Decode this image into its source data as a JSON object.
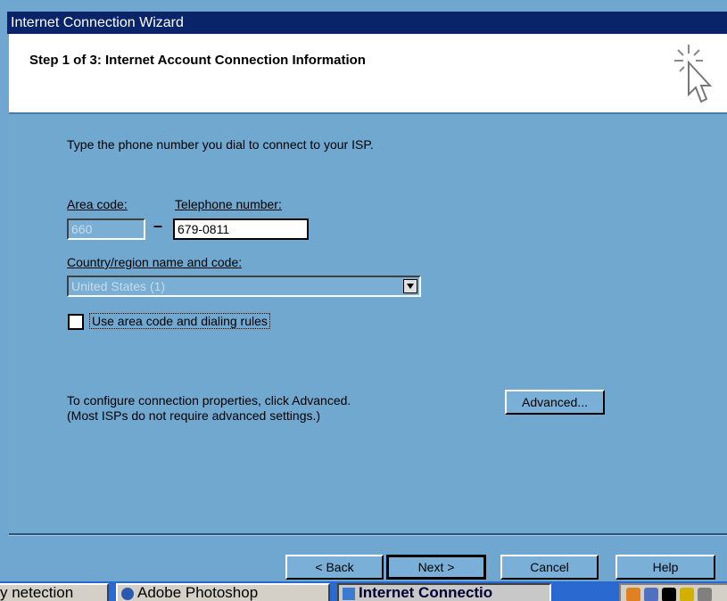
{
  "window": {
    "title": "Internet Connection Wizard"
  },
  "header": {
    "title": "Step 1 of 3: Internet Account Connection Information"
  },
  "instructions": "Type the phone number you dial to connect to your ISP.",
  "area_code": {
    "label": "Area code:",
    "value": "660"
  },
  "telephone": {
    "label": "Telephone number:",
    "value": "679-0811"
  },
  "dash": "–",
  "country": {
    "label": "Country/region name and code:",
    "value": "United States (1)"
  },
  "use_area_code": {
    "label": "Use area code and dialing rules",
    "checked": false
  },
  "advanced": {
    "line1": "To configure connection properties, click Advanced.",
    "line2": "(Most ISPs do not require advanced settings.)",
    "button": "Advanced..."
  },
  "buttons": {
    "back": "< Back",
    "next": "Next >",
    "cancel": "Cancel",
    "help": "Help"
  },
  "taskbar": {
    "tasks": [
      "y netection",
      "Adobe Photoshop",
      "Internet Connectio"
    ]
  },
  "colors": {
    "body_bg": "#70a8d0",
    "titlebar": "#0a246a",
    "taskbar": "#2a6ad0"
  }
}
